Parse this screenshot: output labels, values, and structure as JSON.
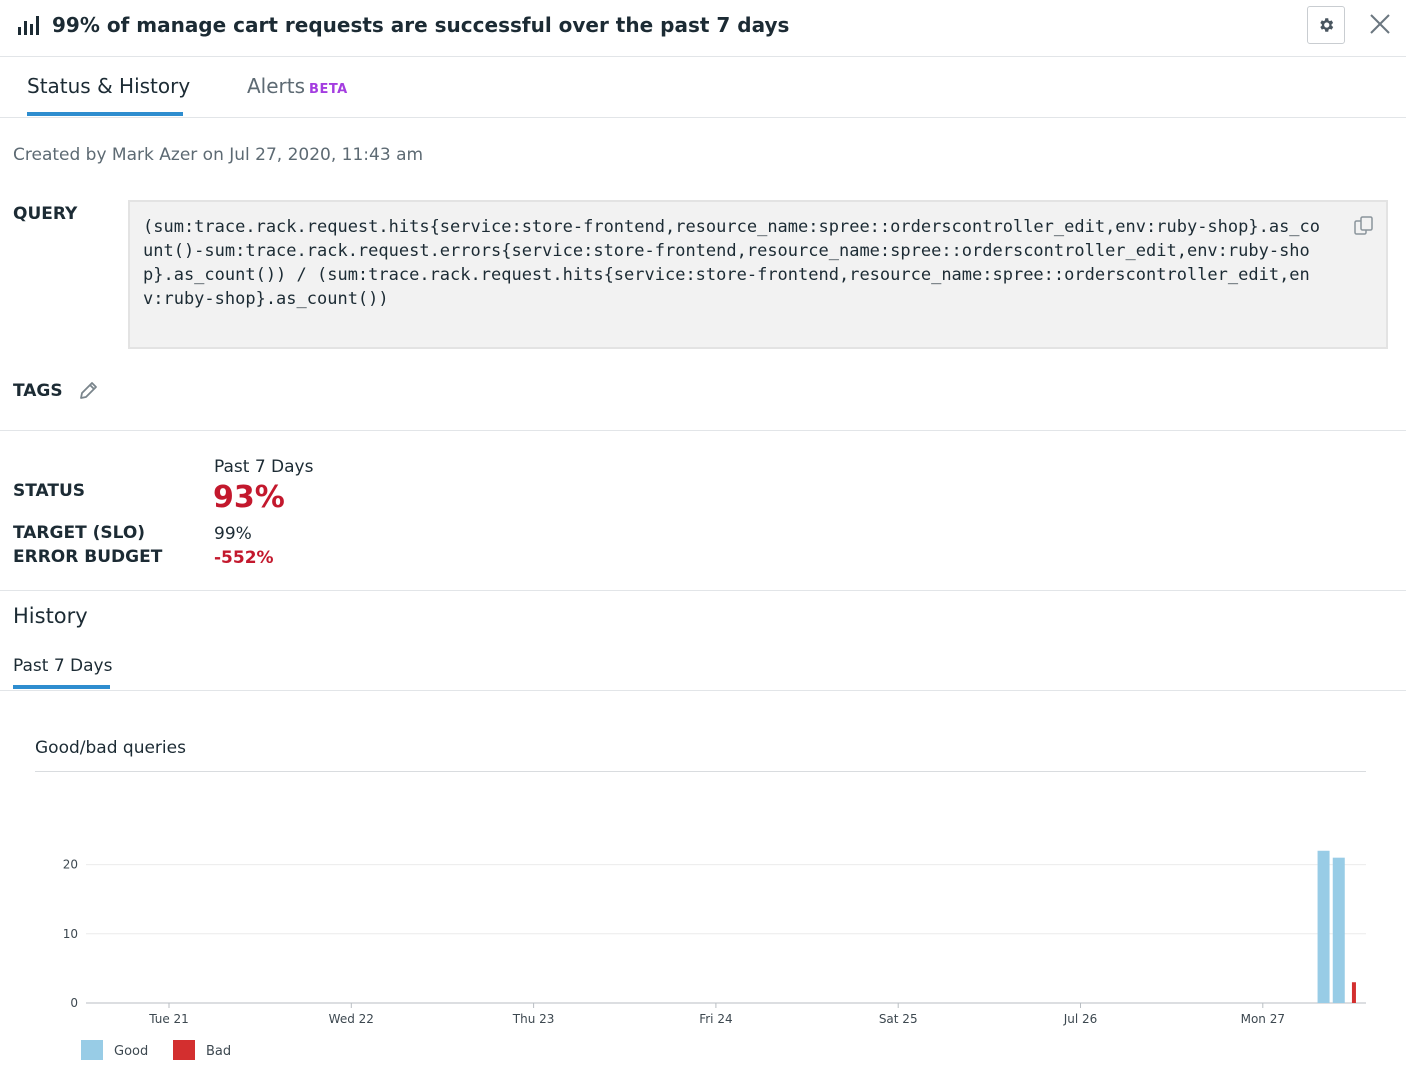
{
  "header": {
    "title": "99% of manage cart requests are successful over the past 7 days",
    "title_icon": "bar-chart-icon",
    "settings_icon": "gear-icon",
    "close_icon": "close-icon"
  },
  "tabs": [
    {
      "label": "Status & History",
      "active": true
    },
    {
      "label": "Alerts",
      "badge": "BETA",
      "active": false
    }
  ],
  "meta": {
    "created": "Created by Mark Azer on Jul 27, 2020, 11:43 am"
  },
  "query": {
    "label": "QUERY",
    "text": "(sum:trace.rack.request.hits{service:store-frontend,resource_name:spree::orderscontroller_edit,env:ruby-shop}.as_count()-sum:trace.rack.request.errors{service:store-frontend,resource_name:spree::orderscontroller_edit,env:ruby-shop}.as_count()) / (sum:trace.rack.request.hits{service:store-frontend,resource_name:spree::orderscontroller_edit,env:ruby-shop}.as_count())",
    "copy_icon": "copy-icon"
  },
  "tags": {
    "label": "TAGS",
    "edit_icon": "pencil-icon"
  },
  "summary": {
    "period": "Past 7 Days",
    "status_label": "STATUS",
    "status_value": "93%",
    "target_label": "TARGET (SLO)",
    "target_value": "99%",
    "budget_label": "ERROR BUDGET",
    "budget_value": "-552%",
    "alert_color": "#c3182d"
  },
  "history": {
    "title": "History",
    "tab": "Past 7 Days"
  },
  "chart_data": {
    "type": "bar",
    "title": "Good/bad queries",
    "x": [
      "Tue 21",
      "Wed 22",
      "Thu 23",
      "Fri 24",
      "Sat 25",
      "Jul 26",
      "Mon 27"
    ],
    "ylim": [
      0,
      25
    ],
    "yticks": [
      0,
      10,
      20
    ],
    "grid": true,
    "legend_position": "bottom-left",
    "series": [
      {
        "name": "Good",
        "color": "#98cce6",
        "points": [
          {
            "x": "Jul 27, 2020, 08:00",
            "y": 22
          },
          {
            "x": "Jul 27, 2020, 10:00",
            "y": 21
          }
        ]
      },
      {
        "name": "Bad",
        "color": "#d32f2f",
        "points": [
          {
            "x": "Jul 27, 2020, 12:00",
            "y": 3
          }
        ]
      }
    ]
  }
}
